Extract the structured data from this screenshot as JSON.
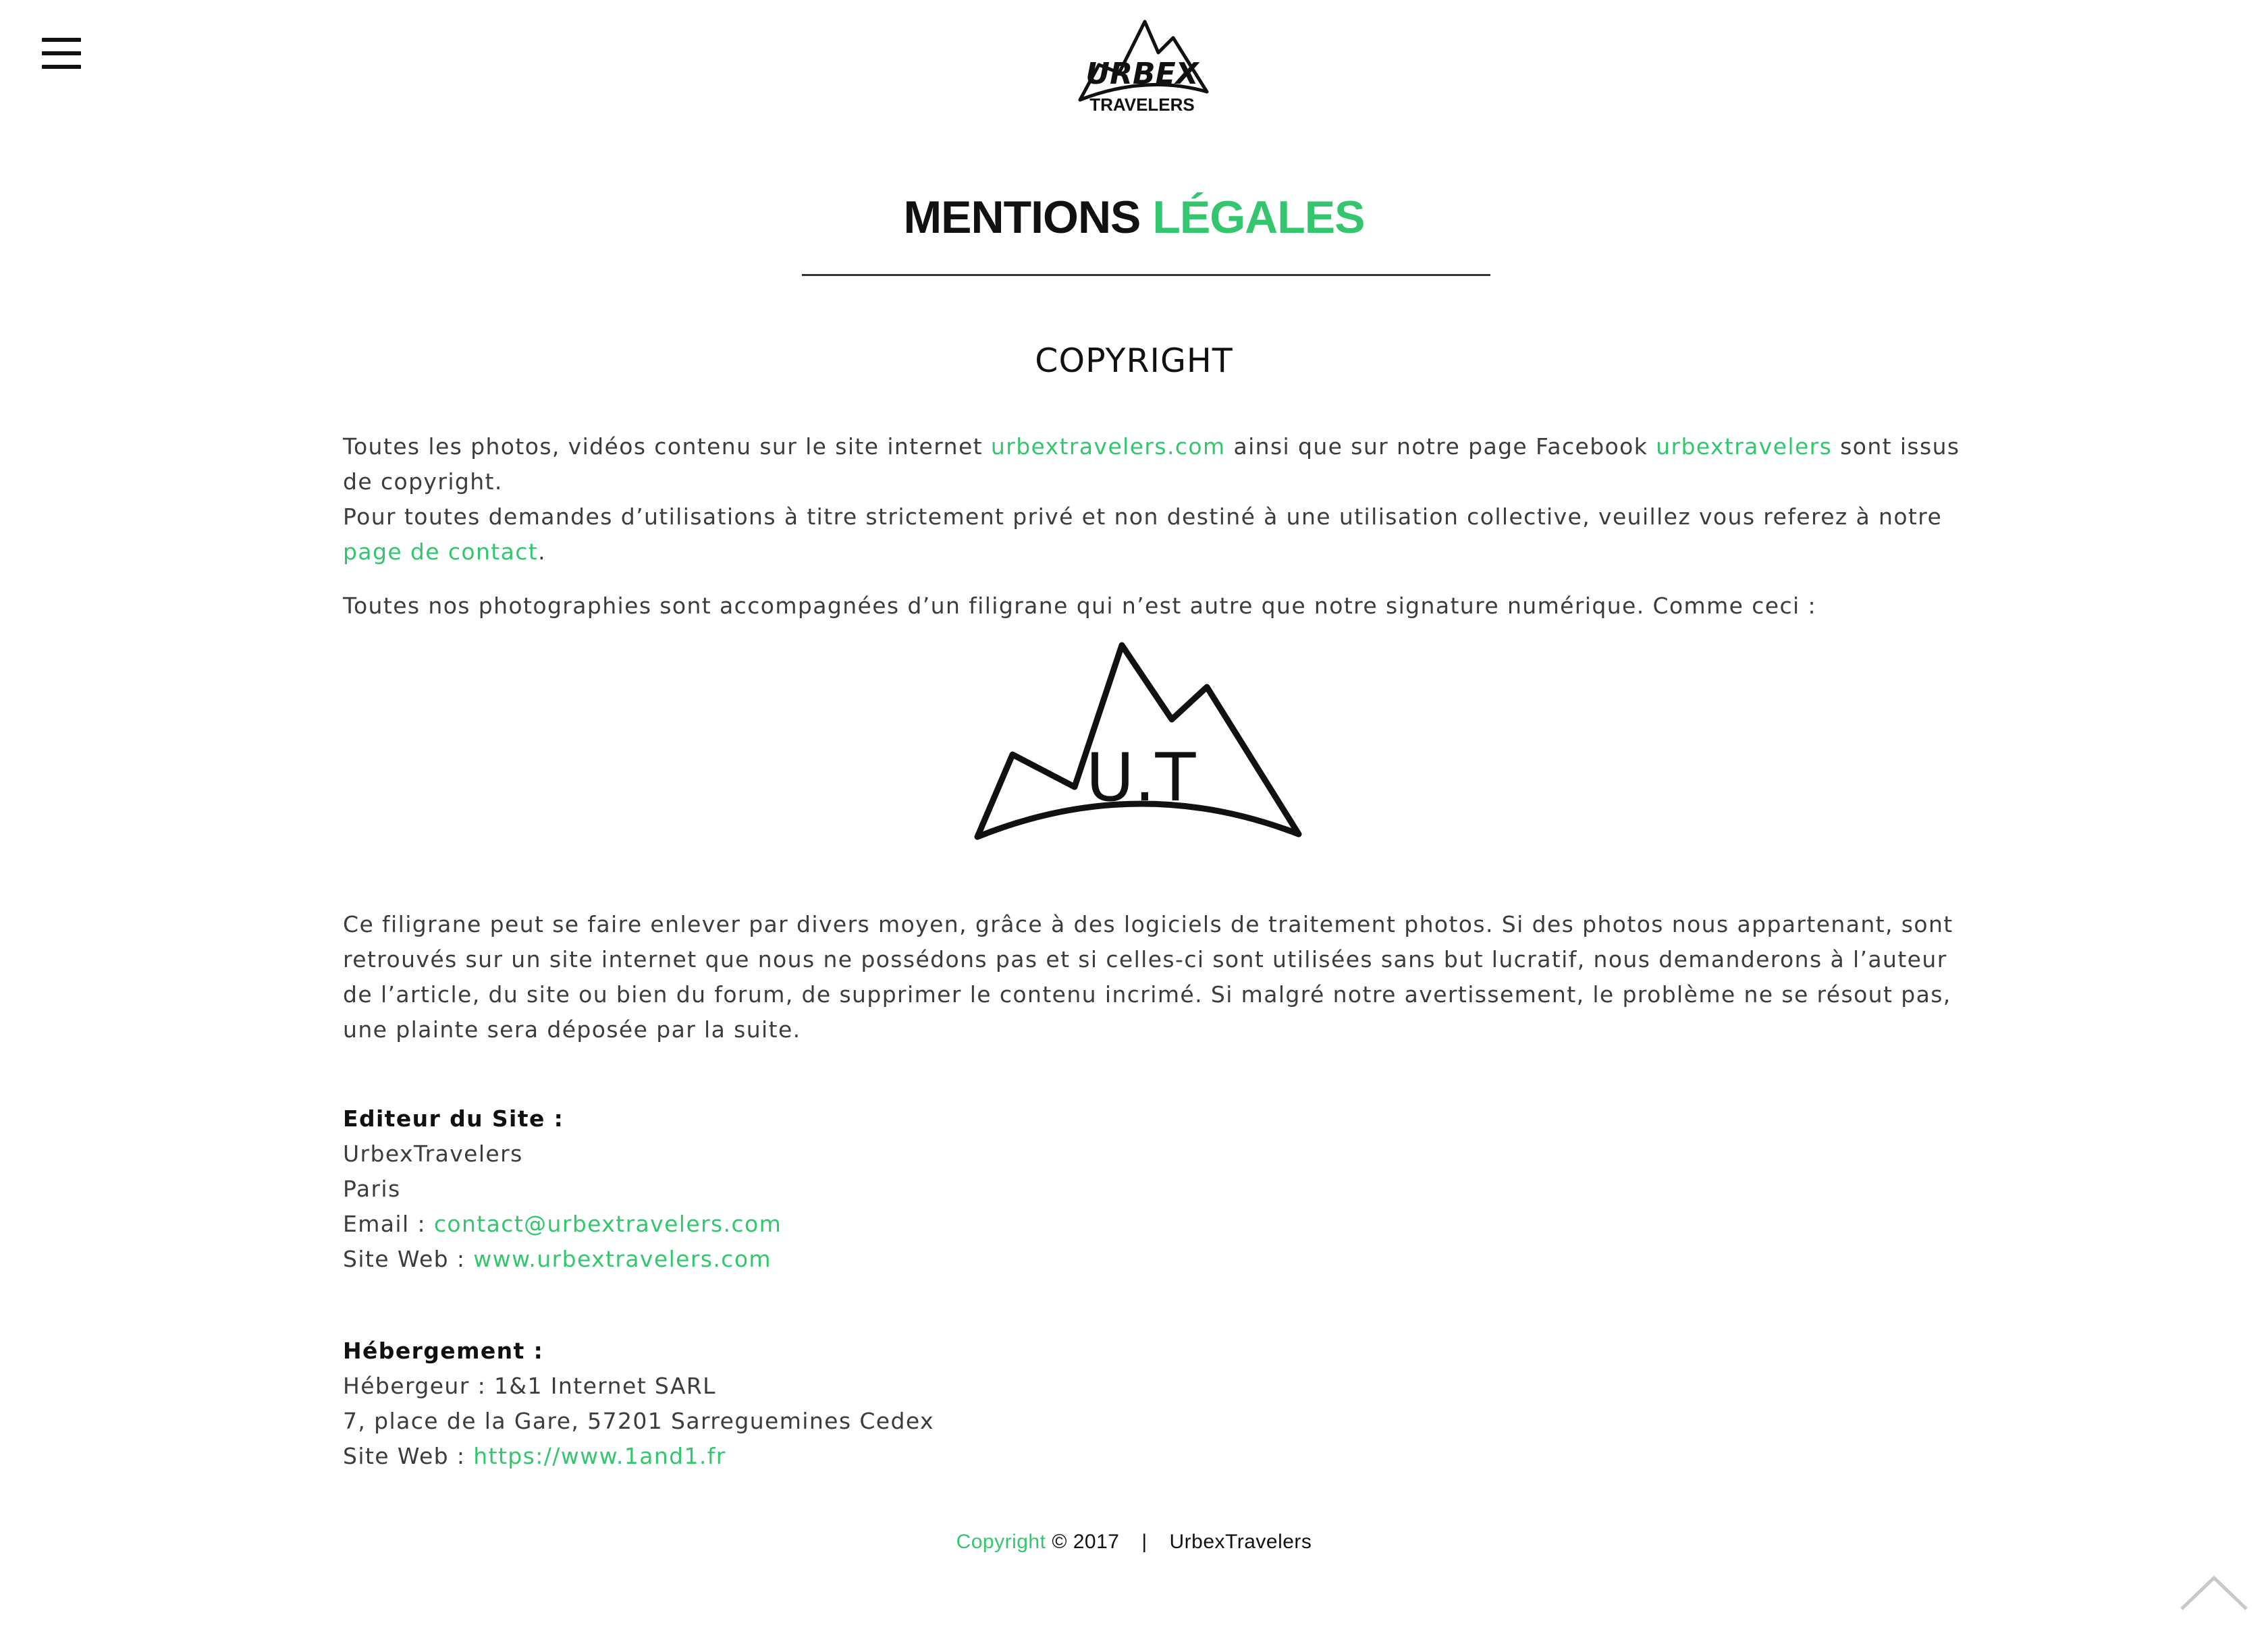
{
  "header": {
    "menu_icon": "hamburger-menu-icon",
    "logo": {
      "icon": "urbex-travelers-logo",
      "word_top": "URBEX",
      "word_bottom": "TRAVELERS"
    }
  },
  "page": {
    "title_part1": "MENTIONS",
    "title_part2": "LÉGALES",
    "section_heading": "COPYRIGHT"
  },
  "copyright": {
    "p1_text1": "Toutes les photos, vidéos contenu sur le site internet ",
    "p1_link1": "urbextravelers.com",
    "p1_text2": " ainsi que sur notre page Facebook ",
    "p1_link2": "urbextravelers",
    "p1_text3": " sont issus de copyright.",
    "p2_text1": "Pour toutes demandes d’utilisations à titre strictement privé et non destiné à une utilisation collective, veuillez vous referez à notre ",
    "p2_link": "page de contact",
    "p2_text2": ".",
    "p3_text": "Toutes nos photographies sont accompagnées d’un filigrane qui n’est autre que notre signature numérique. Comme ceci :",
    "watermark": {
      "icon": "urbex-travelers-watermark",
      "letters": "U.T"
    },
    "p4_text": "Ce filigrane peut se faire enlever par divers moyen, grâce à des logiciels de traitement photos. Si des photos nous appartenant, sont retrouvés sur un site internet que nous ne possédons pas et si celles-ci sont utilisées sans but lucratif, nous demanderons à l’auteur de l’article, du site ou bien du forum, de supprimer le contenu incrimé. Si malgré notre avertissement, le problème ne se résout pas, une plainte sera déposée par la suite."
  },
  "editor": {
    "heading": "Editeur du Site :",
    "name": "UrbexTravelers",
    "city": "Paris",
    "email_label": "Email : ",
    "email": "contact@urbextravelers.com",
    "site_label": "Site Web : ",
    "site": "www.urbextravelers.com"
  },
  "hosting": {
    "heading": "Hébergement :",
    "host": "Hébergeur : 1&1 Internet SARL",
    "address": "7, place de la Gare, 57201 Sarreguemines Cedex",
    "site_label": "Site Web : ",
    "site": "https://www.1and1.fr"
  },
  "footer": {
    "copyright_link": "Copyright",
    "year_text": "© 2017",
    "separator": "|",
    "brand": "UrbexTravelers"
  },
  "scroll_top": {
    "icon": "chevron-up-icon"
  },
  "colors": {
    "accent": "#34c66e",
    "text": "#3c3c3c",
    "heading": "#111111"
  }
}
